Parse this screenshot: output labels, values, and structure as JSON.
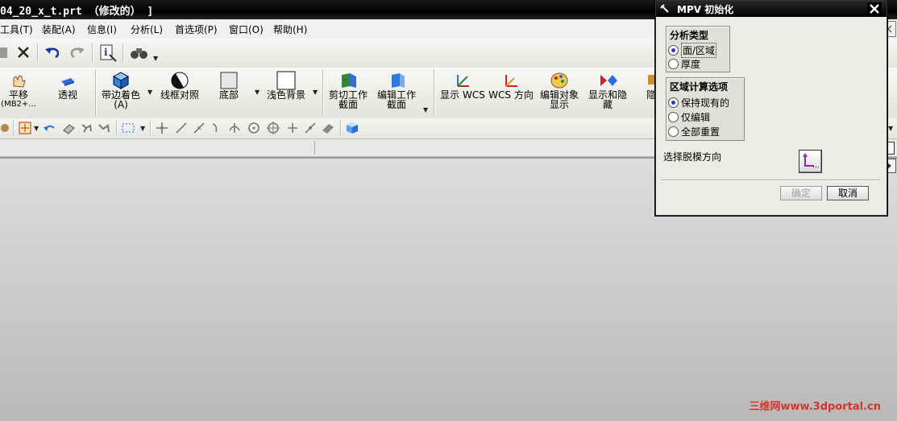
{
  "window": {
    "title": "04_20_x_t.prt （修改的） ]"
  },
  "menubar": [
    {
      "label": "工具(T)"
    },
    {
      "label": "装配(A)"
    },
    {
      "label": "信息(I)"
    },
    {
      "label": "分析(L)"
    },
    {
      "label": "首选项(P)"
    },
    {
      "label": "窗口(O)"
    },
    {
      "label": "帮助(H)"
    }
  ],
  "toolbar_main": [
    {
      "label": "平移",
      "sub": "(MB2+..."
    },
    {
      "label": "透视"
    },
    {
      "label": "带边着色",
      "sub": "(A)"
    },
    {
      "label": "线框对照"
    },
    {
      "label": "底部"
    },
    {
      "label": "浅色背景"
    },
    {
      "label": "剪切工作",
      "sub": "截面"
    },
    {
      "label": "编辑工作",
      "sub": "截面"
    },
    {
      "label": "显示 WCS"
    },
    {
      "label": "WCS 方向"
    },
    {
      "label": "编辑对象",
      "sub": "显示"
    },
    {
      "label": "显示和隐",
      "sub": "藏"
    },
    {
      "label": "隐"
    }
  ],
  "dialog": {
    "title": "MPV 初始化",
    "group1": {
      "title": "分析类型",
      "options": [
        "面/区域",
        "厚度"
      ],
      "selected": 0
    },
    "group2": {
      "title": "区域计算选项",
      "options": [
        "保持现有的",
        "仅编辑",
        "全部重置"
      ],
      "selected": 0
    },
    "pull_direction_label": "选择脱模方向",
    "pull_button": "...",
    "ok_label": "确定",
    "cancel_label": "取消"
  },
  "watermark": "三维网www.3dportal.cn",
  "colors": {
    "title_bar": "#000000",
    "radio_selected": "#1d3fd0",
    "watermark": "#d9322b"
  }
}
